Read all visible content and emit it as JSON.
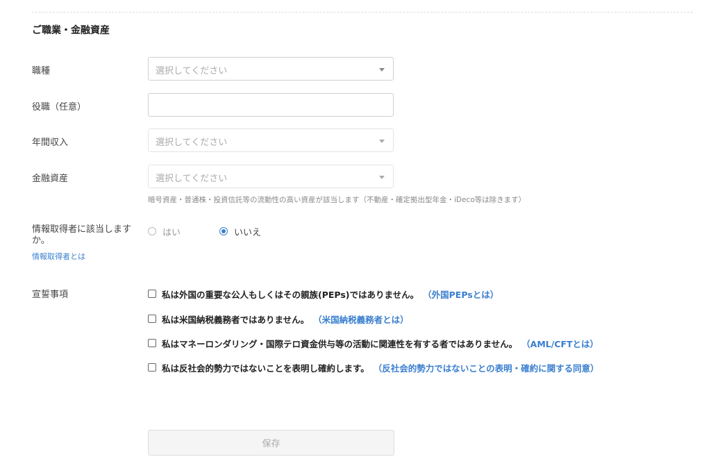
{
  "section": {
    "title": "ご職業・金融資産"
  },
  "fields": {
    "occupation": {
      "label": "職種",
      "placeholder": "選択してください"
    },
    "position": {
      "label": "役職（任意）",
      "value": ""
    },
    "annual_income": {
      "label": "年間収入",
      "placeholder": "選択してください"
    },
    "financial_assets": {
      "label": "金融資産",
      "placeholder": "選択してください",
      "hint": "暗号資産・普通株・投資信託等の流動性の高い資産が該当します（不動産・確定拠出型年金・iDeco等は除きます）"
    }
  },
  "info_acquirer": {
    "question": "情報取得者に該当しますか。",
    "link": "情報取得者とは",
    "options": [
      {
        "label": "はい",
        "checked": false
      },
      {
        "label": "いいえ",
        "checked": true
      }
    ]
  },
  "declarations": {
    "label": "宣誓事項",
    "items": [
      {
        "text": "私は外国の重要な公人もしくはその親族(PEPs)ではありません。",
        "link": "（外国PEPsとは）",
        "checked": false
      },
      {
        "text": "私は米国納税義務者ではありません。",
        "link": "（米国納税義務者とは）",
        "checked": false
      },
      {
        "text": "私はマネーロンダリング・国際テロ資金供与等の活動に関連性を有する者ではありません。",
        "link": "（AML/CFTとは）",
        "checked": false
      },
      {
        "text": "私は反社会的勢力ではないことを表明し確約します。",
        "link": "（反社会的勢力ではないことの表明・確約に関する同意）",
        "checked": false
      }
    ]
  },
  "actions": {
    "save_label": "保存"
  },
  "colors": {
    "link": "#3a7fcf",
    "border": "#cfcfcf",
    "disabled_button_bg": "#f5f5f5"
  }
}
